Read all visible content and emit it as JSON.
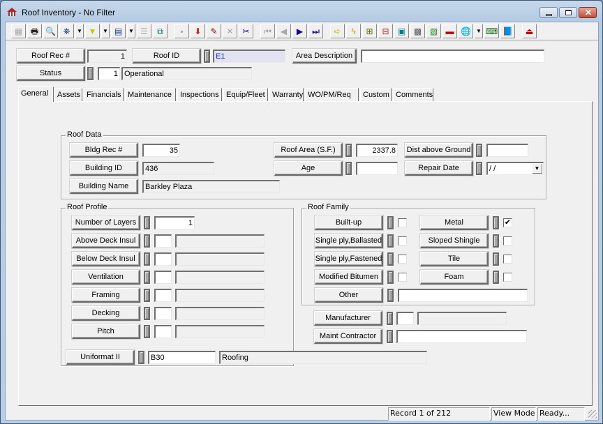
{
  "window": {
    "title": "Roof Inventory - No Filter",
    "icon": "roof-house-icon"
  },
  "toolbar": {
    "buttons": [
      {
        "icon": "select-grid-icon",
        "glyph": "▦",
        "enabled": false
      },
      {
        "icon": "print-icon",
        "glyph": "🖶",
        "enabled": true
      },
      {
        "icon": "print-preview-icon",
        "glyph": "🔍",
        "enabled": true
      },
      {
        "icon": "search-binoculars-icon",
        "glyph": "⛯",
        "enabled": true,
        "dropdown": true
      },
      {
        "icon": "filter-funnel-icon",
        "glyph": "▼",
        "enabled": true,
        "dropdown": true
      },
      {
        "icon": "report-icon",
        "glyph": "▤",
        "enabled": true,
        "dropdown": true
      },
      {
        "icon": "properties-icon",
        "glyph": "☰",
        "enabled": false
      },
      {
        "icon": "copy-document-icon",
        "glyph": "⧉",
        "enabled": true
      },
      {
        "icon": "save-icon",
        "glyph": "▪",
        "enabled": false
      },
      {
        "icon": "add-record-icon",
        "glyph": "⬇",
        "enabled": true
      },
      {
        "icon": "edit-pencil-icon",
        "glyph": "✎",
        "enabled": true
      },
      {
        "icon": "delete-x-icon",
        "glyph": "✕",
        "enabled": false
      },
      {
        "icon": "cut-scissors-icon",
        "glyph": "✂",
        "enabled": true
      },
      {
        "icon": "first-record-icon",
        "glyph": "⏮",
        "enabled": false
      },
      {
        "icon": "previous-record-icon",
        "glyph": "◀",
        "enabled": false
      },
      {
        "icon": "next-record-icon",
        "glyph": "▶",
        "enabled": true
      },
      {
        "icon": "last-record-icon",
        "glyph": "⏭",
        "enabled": true
      },
      {
        "icon": "goto-arrow-icon",
        "glyph": "➪",
        "enabled": true
      },
      {
        "icon": "quick-action-lightning-icon",
        "glyph": "ϟ",
        "enabled": true
      },
      {
        "icon": "hierarchy-icon",
        "glyph": "⊞",
        "enabled": true
      },
      {
        "icon": "relationships-icon",
        "glyph": "⊟",
        "enabled": true
      },
      {
        "icon": "equipment-icon",
        "glyph": "▣",
        "enabled": true
      },
      {
        "icon": "calculator-icon",
        "glyph": "▩",
        "enabled": true
      },
      {
        "icon": "floor-plan-icon",
        "glyph": "▧",
        "enabled": true
      },
      {
        "icon": "toolbox-icon",
        "glyph": "▬",
        "enabled": true
      },
      {
        "icon": "web-globe-icon",
        "glyph": "🌐",
        "enabled": true,
        "dropdown": true
      },
      {
        "icon": "keyboard-icon",
        "glyph": "⌨",
        "enabled": true
      },
      {
        "icon": "help-book-icon",
        "glyph": "📘",
        "enabled": true
      },
      {
        "icon": "exit-icon",
        "glyph": "⏏",
        "enabled": true
      }
    ]
  },
  "header": {
    "roof_rec_label": "Roof Rec #",
    "roof_rec_value": "1",
    "roof_id_label": "Roof ID",
    "roof_id_value": "E1",
    "area_desc_label": "Area Description",
    "area_desc_value": "",
    "status_label": "Status",
    "status_code": "1",
    "status_text": "Operational"
  },
  "tabs": [
    "General",
    "Assets",
    "Financials",
    "Maintenance",
    "Inspections",
    "Equip/Fleet",
    "Warranty",
    "WO/PM/Req",
    "Custom",
    "Comments"
  ],
  "active_tab": "General",
  "roof_data": {
    "title": "Roof Data",
    "bldg_rec_label": "Bldg Rec #",
    "bldg_rec_value": "35",
    "building_id_label": "Building ID",
    "building_id_value": "436",
    "building_name_label": "Building Name",
    "building_name_value": "Barkley Plaza",
    "roof_area_label": "Roof Area (S.F.)",
    "roof_area_value": "2337.8",
    "age_label": "Age",
    "age_value": "",
    "dist_ground_label": "Dist above Ground",
    "dist_ground_value": "",
    "repair_date_label": "Repair Date",
    "repair_date_value": " /  /"
  },
  "roof_profile": {
    "title": "Roof Profile",
    "layers_label": "Number of Layers",
    "layers_value": "1",
    "rows": [
      {
        "label": "Above Deck Insul",
        "code": "",
        "desc": ""
      },
      {
        "label": "Below Deck Insul",
        "code": "",
        "desc": ""
      },
      {
        "label": "Ventilation",
        "code": "",
        "desc": ""
      },
      {
        "label": "Framing",
        "code": "",
        "desc": ""
      },
      {
        "label": "Decking",
        "code": "",
        "desc": ""
      },
      {
        "label": "Pitch",
        "code": "",
        "desc": ""
      }
    ]
  },
  "roof_family": {
    "title": "Roof Family",
    "left": [
      {
        "label": "Built-up",
        "checked": false
      },
      {
        "label": "Single ply,Ballasted",
        "checked": false
      },
      {
        "label": "Single ply,Fastened",
        "checked": false
      },
      {
        "label": "Modified Bitumen",
        "checked": false
      }
    ],
    "right": [
      {
        "label": "Metal",
        "checked": true
      },
      {
        "label": "Sloped Shingle",
        "checked": false
      },
      {
        "label": "Tile",
        "checked": false
      },
      {
        "label": "Foam",
        "checked": false
      }
    ],
    "other_label": "Other",
    "other_value": "",
    "check_glyph": "✔"
  },
  "manufacturer": {
    "label": "Manufacturer",
    "code": "",
    "desc": ""
  },
  "maint_contractor": {
    "label": "Maint Contractor",
    "value": ""
  },
  "uniformat": {
    "label": "Uniformat II",
    "code": "B30",
    "desc": "Roofing"
  },
  "statusbar": {
    "record": "Record 1 of 212",
    "mode": "View Mode",
    "state": "Ready..."
  }
}
